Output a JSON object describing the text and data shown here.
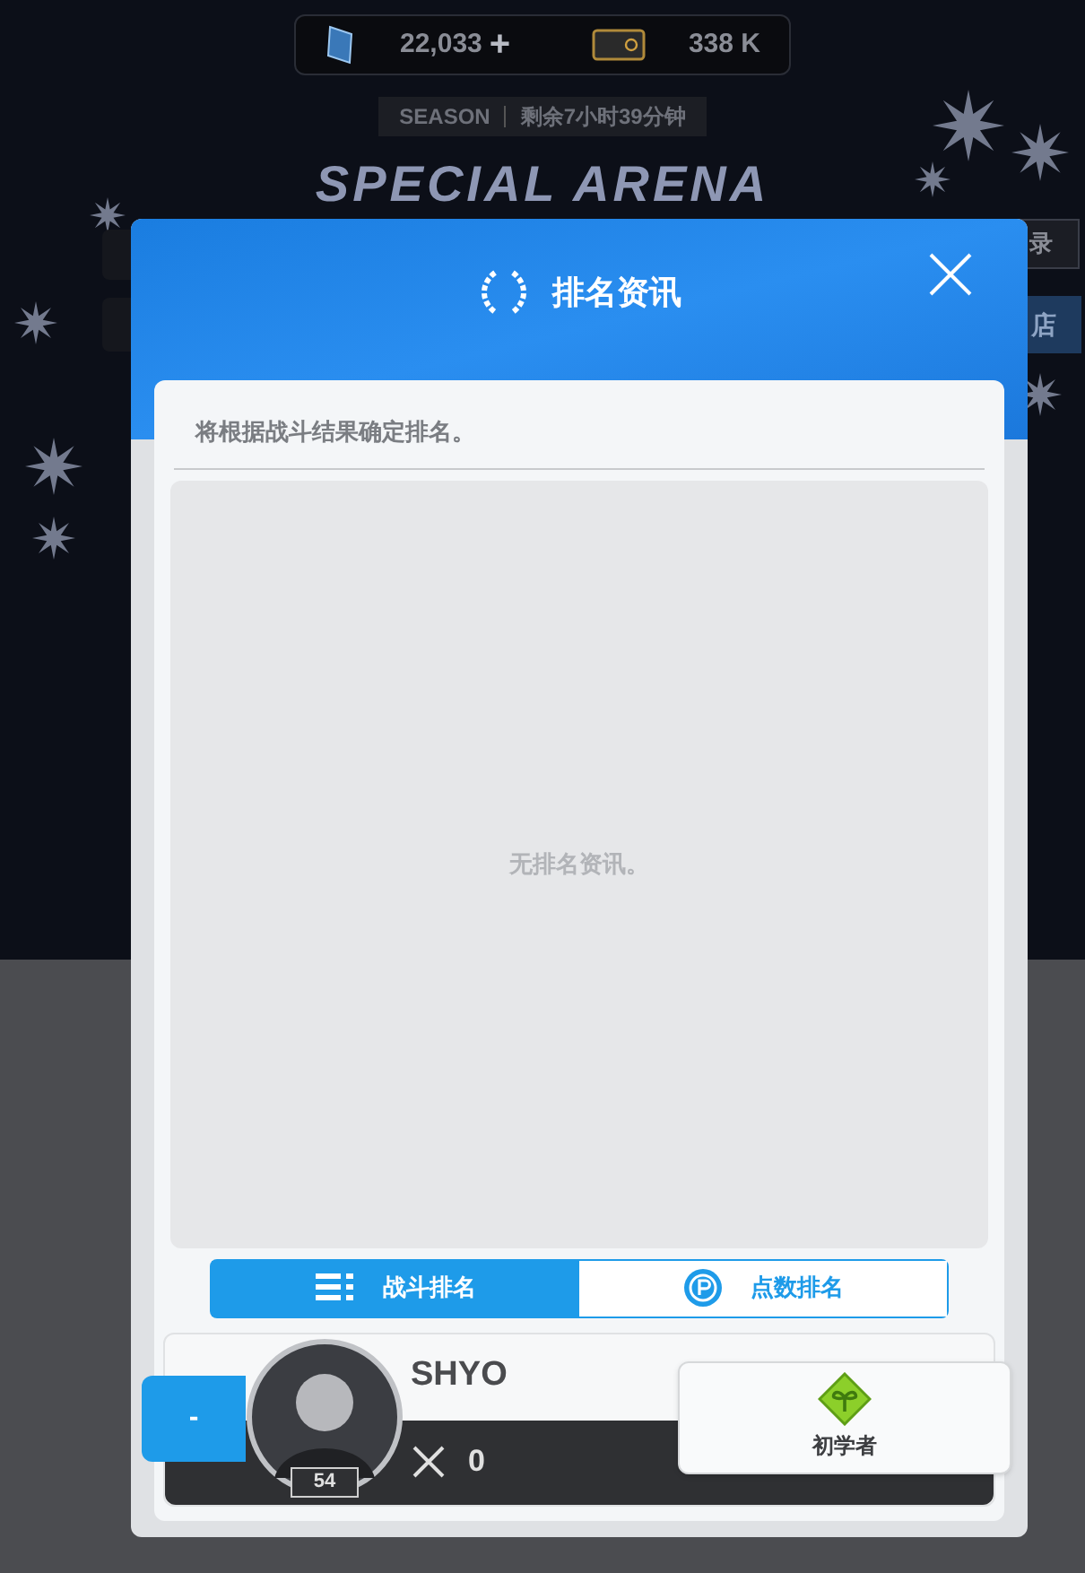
{
  "currency": [
    {
      "kind": "crystal",
      "amount": "22,033",
      "add": "+"
    },
    {
      "kind": "ticket",
      "amount": "338 K"
    }
  ],
  "season": {
    "label": "SEASON",
    "remaining": "剩余7小时39分钟"
  },
  "arena_title": "SPECIAL ARENA",
  "side_buttons": [
    {
      "label": "录"
    },
    {
      "label": "店"
    }
  ],
  "dialog": {
    "title": "排名资讯",
    "note": "将根据战斗结果确定排名。",
    "empty_message": "无排名资讯。",
    "tabs": [
      {
        "kind": "battle",
        "label": "战斗排名",
        "selected": true
      },
      {
        "kind": "points",
        "label": "点数排名",
        "selected": false
      }
    ],
    "player": {
      "rank": "-",
      "level": "54",
      "name": "SHYO",
      "wins": "0",
      "tier": "初学者"
    }
  }
}
